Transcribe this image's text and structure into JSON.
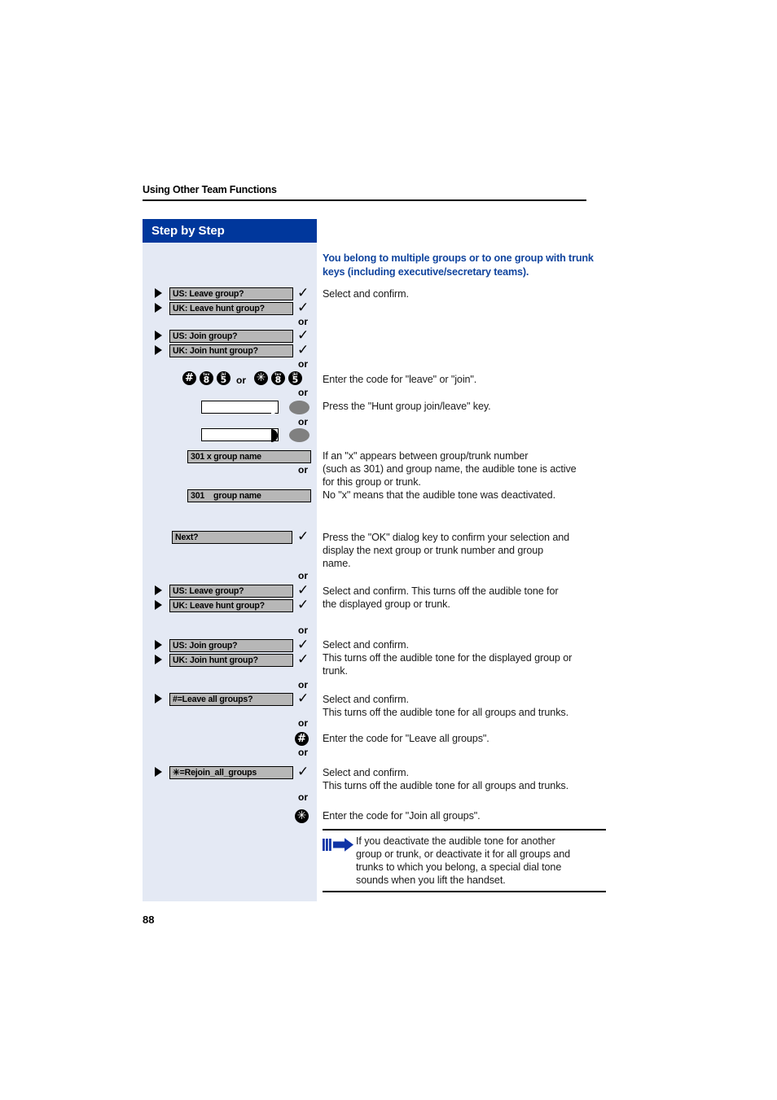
{
  "page": {
    "running_head": "Using Other Team Functions",
    "folio": "88",
    "sidebar_title": "Step by Step"
  },
  "colors": {
    "header_blue": "#00379c",
    "sidebar_bg": "#e4e9f4",
    "heading_blue": "#10449e",
    "display_grey": "#b7b7b7",
    "key_black": "#000000",
    "fkey_grey": "#808080",
    "note_arrow_blue": "#1034a6"
  },
  "headings": {
    "section": "You belong to multiple groups or to one group with trunk keys (including executive/secretary teams)."
  },
  "or_label": "or",
  "steps": [
    {
      "id": "leave-group-1",
      "kind": "display-pair",
      "options": [
        {
          "label": "US: Leave group?",
          "confirm": "✓"
        },
        {
          "label": "UK: Leave hunt group?",
          "confirm": "✓"
        }
      ],
      "instruction": "Select and confirm."
    },
    {
      "id": "join-group-1",
      "kind": "display-pair",
      "options": [
        {
          "label": "US: Join group?",
          "confirm": "✓"
        },
        {
          "label": "UK: Join hunt group?",
          "confirm": "✓"
        }
      ],
      "instruction": ""
    },
    {
      "id": "enter-code-leave-join",
      "kind": "keypad",
      "codes": [
        [
          {
            "digit": "#",
            "letters": ""
          },
          {
            "digit": "8",
            "letters": "tuv"
          },
          {
            "digit": "5",
            "letters": "jkl"
          }
        ],
        [
          {
            "digit": "✳",
            "letters": ""
          },
          {
            "digit": "8",
            "letters": "tuv"
          },
          {
            "digit": "5",
            "letters": "jkl"
          }
        ]
      ],
      "separator": "or",
      "instruction": "Enter the code for \"leave\" or \"join\"."
    },
    {
      "id": "hunt-group-key",
      "kind": "function-key",
      "led": "off",
      "instruction": "Press the \"Hunt group join/leave\" key."
    },
    {
      "id": "hunt-group-key-lit",
      "kind": "function-key",
      "led": "on",
      "instruction": ""
    },
    {
      "id": "display-301-x",
      "kind": "display-wide",
      "label": "301 x group name",
      "instruction": "If an \"x\" appears between group/trunk number\n(such as 301) and group name, the audible tone is active\nfor this group or trunk."
    },
    {
      "id": "display-301",
      "kind": "display-wide",
      "label": "301    group name",
      "instruction": "No \"x\" means that the audible tone was deactivated."
    },
    {
      "id": "next",
      "kind": "display-plain",
      "label": "Next?",
      "confirm": "✓",
      "instruction": "Press the \"OK\" dialog key to confirm your selection and display the next group or trunk number and group name."
    },
    {
      "id": "leave-group-2",
      "kind": "display-pair",
      "options": [
        {
          "label": "US: Leave group?",
          "confirm": "✓"
        },
        {
          "label": "UK: Leave hunt group?",
          "confirm": "✓"
        }
      ],
      "instruction": "Select and confirm. This turns off the audible tone for the displayed group or trunk."
    },
    {
      "id": "join-group-2",
      "kind": "display-pair",
      "options": [
        {
          "label": "US: Join group?",
          "confirm": "✓"
        },
        {
          "label": "UK: Join hunt group?",
          "confirm": "✓"
        }
      ],
      "instruction": "Select and confirm.\nThis turns off the audible tone for the displayed group or trunk."
    },
    {
      "id": "leave-all-groups",
      "kind": "display-single",
      "label": "#=Leave all groups?",
      "confirm": "✓",
      "instruction": "Select and confirm.\nThis turns off the audible tone for all groups and trunks."
    },
    {
      "id": "code-leave-all",
      "kind": "single-key",
      "key": "#",
      "instruction": "Enter the code for \"Leave all groups\"."
    },
    {
      "id": "rejoin-all-groups",
      "kind": "display-single",
      "label": "✳=Rejoin_all_groups",
      "confirm": "✓",
      "instruction": "Select and confirm.\nThis turns off the audible tone for all groups and trunks."
    },
    {
      "id": "code-join-all",
      "kind": "single-key",
      "key": "✳",
      "instruction": "Enter the code for \"Join all groups\"."
    }
  ],
  "labels": {
    "leave_group_us": "US: Leave group?",
    "leave_group_uk": "UK: Leave hunt group?",
    "join_group_us": "US: Join group?",
    "join_group_uk": "UK: Join hunt group?",
    "next": "Next?",
    "display_301_x": "301 x group name",
    "display_301": "301    group name",
    "leave_all": "#=Leave all groups?",
    "rejoin_all": "✳=Rejoin_all_groups",
    "check": "✓",
    "key_sep_or": "or"
  },
  "instructions": {
    "select_confirm": "Select and confirm.",
    "enter_code_leave_join": "Enter the code for \"leave\" or \"join\".",
    "press_hunt_key": "Press the \"Hunt group join/leave\" key.",
    "x_explain_l1": "If an \"x\" appears between group/trunk number",
    "x_explain_l2": "(such as 301) and group name, the audible tone is active",
    "x_explain_l3": "for this group or trunk.",
    "x_explain_l4": "No \"x\" means that the audible tone was deactivated.",
    "press_ok_l1": "Press the \"OK\" dialog key to confirm your selection and",
    "press_ok_l2": "display the next group or trunk number and group",
    "press_ok_l3": "name.",
    "select_confirm_turnsoff_l1": "Select and confirm. This turns off the audible tone for",
    "select_confirm_turnsoff_l2": "the displayed group or trunk.",
    "select_confirm_2_l1": "Select and confirm.",
    "select_confirm_2_l2": "This turns off the audible tone for the displayed group or",
    "select_confirm_2_l3": "trunk.",
    "select_confirm_all_l1": "Select and confirm.",
    "select_confirm_all_l2": "This turns off the audible tone for all groups and trunks.",
    "enter_code_leave_all": "Enter the code for \"Leave all groups\".",
    "select_confirm_all2_l1": "Select and confirm.",
    "select_confirm_all2_l2": "This turns off the audible tone for all groups and trunks.",
    "enter_code_join_all": "Enter the code for \"Join all groups\"."
  },
  "note": {
    "line1": "If you deactivate the audible tone for another",
    "line2": "group or trunk, or deactivate it for all groups and",
    "line3": "trunks to which you belong, a special dial tone",
    "line4": "sounds when you lift the handset."
  },
  "keypad": {
    "hash": "#",
    "star": "✳",
    "eight": "8",
    "eight_letters": "tuv",
    "five": "5",
    "five_letters": "jkl"
  }
}
